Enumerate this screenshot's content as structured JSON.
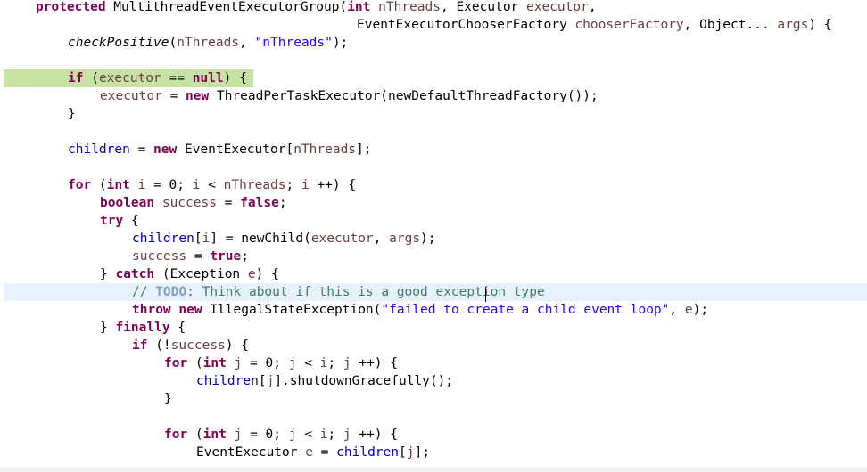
{
  "editor": {
    "language": "java",
    "colors": {
      "keyword": "#7f0055",
      "field": "#0000c0",
      "local_variable": "#6a3e3e",
      "string": "#2a00ff",
      "comment": "#3f7f5f",
      "todo_tag": "#7f9fbf",
      "breakpoint_highlight": "#c6e3a4",
      "current_line_highlight": "#e8f2fe"
    },
    "lines": [
      {
        "indent": 1,
        "tokens": [
          {
            "t": "protected",
            "c": "kw"
          },
          {
            "t": " MultithreadEventExecutorGroup(",
            "c": "plain"
          },
          {
            "t": "int",
            "c": "kw"
          },
          {
            "t": " ",
            "c": "plain"
          },
          {
            "t": "nThreads",
            "c": "var"
          },
          {
            "t": ", Executor ",
            "c": "plain"
          },
          {
            "t": "executor",
            "c": "var"
          },
          {
            "t": ",",
            "c": "plain"
          }
        ]
      },
      {
        "indent": 11,
        "tokens": [
          {
            "t": "EventExecutorChooserFactory ",
            "c": "plain"
          },
          {
            "t": "chooserFactory",
            "c": "var"
          },
          {
            "t": ", Object... ",
            "c": "plain"
          },
          {
            "t": "args",
            "c": "var"
          },
          {
            "t": ") {",
            "c": "plain"
          }
        ]
      },
      {
        "indent": 2,
        "tokens": [
          {
            "t": "checkPositive",
            "c": "static"
          },
          {
            "t": "(",
            "c": "plain"
          },
          {
            "t": "nThreads",
            "c": "var"
          },
          {
            "t": ", ",
            "c": "plain"
          },
          {
            "t": "\"nThreads\"",
            "c": "str"
          },
          {
            "t": ");",
            "c": "plain"
          }
        ]
      },
      {
        "indent": 0,
        "tokens": []
      },
      {
        "indent": 2,
        "highlight": "green",
        "tokens": [
          {
            "t": "if",
            "c": "kw"
          },
          {
            "t": " (",
            "c": "plain"
          },
          {
            "t": "executor",
            "c": "var"
          },
          {
            "t": " == ",
            "c": "plain"
          },
          {
            "t": "null",
            "c": "kw"
          },
          {
            "t": ") {",
            "c": "plain"
          }
        ]
      },
      {
        "indent": 3,
        "tokens": [
          {
            "t": "executor",
            "c": "var"
          },
          {
            "t": " = ",
            "c": "plain"
          },
          {
            "t": "new",
            "c": "kw"
          },
          {
            "t": " ThreadPerTaskExecutor(newDefaultThreadFactory());",
            "c": "plain"
          }
        ]
      },
      {
        "indent": 2,
        "tokens": [
          {
            "t": "}",
            "c": "plain"
          }
        ]
      },
      {
        "indent": 0,
        "tokens": []
      },
      {
        "indent": 2,
        "tokens": [
          {
            "t": "children",
            "c": "field"
          },
          {
            "t": " = ",
            "c": "plain"
          },
          {
            "t": "new",
            "c": "kw"
          },
          {
            "t": " EventExecutor[",
            "c": "plain"
          },
          {
            "t": "nThreads",
            "c": "var"
          },
          {
            "t": "];",
            "c": "plain"
          }
        ]
      },
      {
        "indent": 0,
        "tokens": []
      },
      {
        "indent": 2,
        "tokens": [
          {
            "t": "for",
            "c": "kw"
          },
          {
            "t": " (",
            "c": "plain"
          },
          {
            "t": "int",
            "c": "kw"
          },
          {
            "t": " ",
            "c": "plain"
          },
          {
            "t": "i",
            "c": "var"
          },
          {
            "t": " = 0; ",
            "c": "plain"
          },
          {
            "t": "i",
            "c": "var"
          },
          {
            "t": " < ",
            "c": "plain"
          },
          {
            "t": "nThreads",
            "c": "var"
          },
          {
            "t": "; ",
            "c": "plain"
          },
          {
            "t": "i",
            "c": "var"
          },
          {
            "t": " ++) {",
            "c": "plain"
          }
        ]
      },
      {
        "indent": 3,
        "tokens": [
          {
            "t": "boolean",
            "c": "kw"
          },
          {
            "t": " ",
            "c": "plain"
          },
          {
            "t": "success",
            "c": "var"
          },
          {
            "t": " = ",
            "c": "plain"
          },
          {
            "t": "false",
            "c": "kw"
          },
          {
            "t": ";",
            "c": "plain"
          }
        ]
      },
      {
        "indent": 3,
        "tokens": [
          {
            "t": "try",
            "c": "kw"
          },
          {
            "t": " {",
            "c": "plain"
          }
        ]
      },
      {
        "indent": 4,
        "tokens": [
          {
            "t": "children",
            "c": "field"
          },
          {
            "t": "[",
            "c": "plain"
          },
          {
            "t": "i",
            "c": "var"
          },
          {
            "t": "] = newChild(",
            "c": "plain"
          },
          {
            "t": "executor",
            "c": "var"
          },
          {
            "t": ", ",
            "c": "plain"
          },
          {
            "t": "args",
            "c": "var"
          },
          {
            "t": ");",
            "c": "plain"
          }
        ]
      },
      {
        "indent": 4,
        "tokens": [
          {
            "t": "success",
            "c": "var"
          },
          {
            "t": " = ",
            "c": "plain"
          },
          {
            "t": "true",
            "c": "kw"
          },
          {
            "t": ";",
            "c": "plain"
          }
        ]
      },
      {
        "indent": 3,
        "tokens": [
          {
            "t": "} ",
            "c": "plain"
          },
          {
            "t": "catch",
            "c": "kw"
          },
          {
            "t": " (Exception ",
            "c": "plain"
          },
          {
            "t": "e",
            "c": "var"
          },
          {
            "t": ") {",
            "c": "plain"
          }
        ]
      },
      {
        "indent": 4,
        "highlight": "current",
        "tokens": [
          {
            "t": "// ",
            "c": "cmt"
          },
          {
            "t": "TODO",
            "c": "todo"
          },
          {
            "t": ": Think about if this is a good exception type",
            "c": "cmt"
          }
        ]
      },
      {
        "indent": 4,
        "tokens": [
          {
            "t": "throw",
            "c": "kw"
          },
          {
            "t": " ",
            "c": "plain"
          },
          {
            "t": "new",
            "c": "kw"
          },
          {
            "t": " IllegalStateException(",
            "c": "plain"
          },
          {
            "t": "\"failed to create a child event loop\"",
            "c": "str"
          },
          {
            "t": ", ",
            "c": "plain"
          },
          {
            "t": "e",
            "c": "var"
          },
          {
            "t": ");",
            "c": "plain"
          }
        ]
      },
      {
        "indent": 3,
        "tokens": [
          {
            "t": "} ",
            "c": "plain"
          },
          {
            "t": "finally",
            "c": "kw"
          },
          {
            "t": " {",
            "c": "plain"
          }
        ]
      },
      {
        "indent": 4,
        "tokens": [
          {
            "t": "if",
            "c": "kw"
          },
          {
            "t": " (!",
            "c": "plain"
          },
          {
            "t": "success",
            "c": "var"
          },
          {
            "t": ") {",
            "c": "plain"
          }
        ]
      },
      {
        "indent": 5,
        "tokens": [
          {
            "t": "for",
            "c": "kw"
          },
          {
            "t": " (",
            "c": "plain"
          },
          {
            "t": "int",
            "c": "kw"
          },
          {
            "t": " ",
            "c": "plain"
          },
          {
            "t": "j",
            "c": "var"
          },
          {
            "t": " = 0; ",
            "c": "plain"
          },
          {
            "t": "j",
            "c": "var"
          },
          {
            "t": " < ",
            "c": "plain"
          },
          {
            "t": "i",
            "c": "var"
          },
          {
            "t": "; ",
            "c": "plain"
          },
          {
            "t": "j",
            "c": "var"
          },
          {
            "t": " ++) {",
            "c": "plain"
          }
        ]
      },
      {
        "indent": 6,
        "tokens": [
          {
            "t": "children",
            "c": "field"
          },
          {
            "t": "[",
            "c": "plain"
          },
          {
            "t": "j",
            "c": "var"
          },
          {
            "t": "].shutdownGracefully();",
            "c": "plain"
          }
        ]
      },
      {
        "indent": 5,
        "tokens": [
          {
            "t": "}",
            "c": "plain"
          }
        ]
      },
      {
        "indent": 0,
        "tokens": []
      },
      {
        "indent": 5,
        "tokens": [
          {
            "t": "for",
            "c": "kw"
          },
          {
            "t": " (",
            "c": "plain"
          },
          {
            "t": "int",
            "c": "kw"
          },
          {
            "t": " ",
            "c": "plain"
          },
          {
            "t": "j",
            "c": "var"
          },
          {
            "t": " = 0; ",
            "c": "plain"
          },
          {
            "t": "j",
            "c": "var"
          },
          {
            "t": " < ",
            "c": "plain"
          },
          {
            "t": "i",
            "c": "var"
          },
          {
            "t": "; ",
            "c": "plain"
          },
          {
            "t": "j",
            "c": "var"
          },
          {
            "t": " ++) {",
            "c": "plain"
          }
        ]
      },
      {
        "indent": 6,
        "tokens": [
          {
            "t": "EventExecutor ",
            "c": "plain"
          },
          {
            "t": "e",
            "c": "var"
          },
          {
            "t": " = ",
            "c": "plain"
          },
          {
            "t": "children",
            "c": "field"
          },
          {
            "t": "[",
            "c": "plain"
          },
          {
            "t": "j",
            "c": "var"
          },
          {
            "t": "];",
            "c": "plain"
          }
        ]
      }
    ]
  }
}
